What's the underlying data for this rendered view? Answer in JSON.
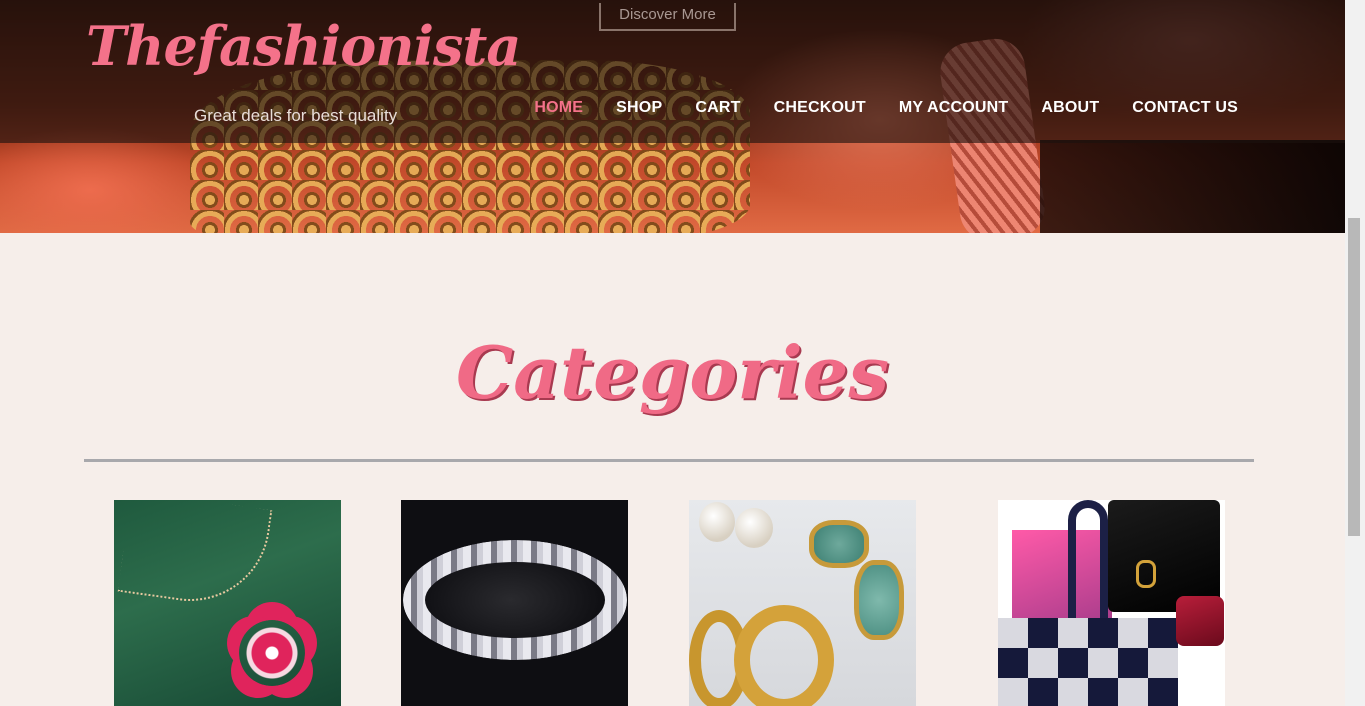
{
  "header": {
    "discover_label": "Discover More",
    "logo": "Thefashionista",
    "tagline": "Great deals for best quality",
    "nav": [
      {
        "label": "HOME",
        "active": true
      },
      {
        "label": "SHOP",
        "active": false
      },
      {
        "label": "CART",
        "active": false
      },
      {
        "label": "CHECKOUT",
        "active": false
      },
      {
        "label": "MY ACCOUNT",
        "active": false
      },
      {
        "label": "ABOUT",
        "active": false
      },
      {
        "label": "CONTACT US",
        "active": false
      }
    ]
  },
  "categories": {
    "title": "Categories",
    "items": [
      {
        "image": "pink-flower-pendant-necklace"
      },
      {
        "image": "silver-crystal-bracelet"
      },
      {
        "image": "gold-and-turquoise-earrings"
      },
      {
        "image": "handbags-collection"
      }
    ]
  },
  "colors": {
    "accent": "#f4728a",
    "page_background": "#f6eeea",
    "divider": "#a8a8ac"
  }
}
